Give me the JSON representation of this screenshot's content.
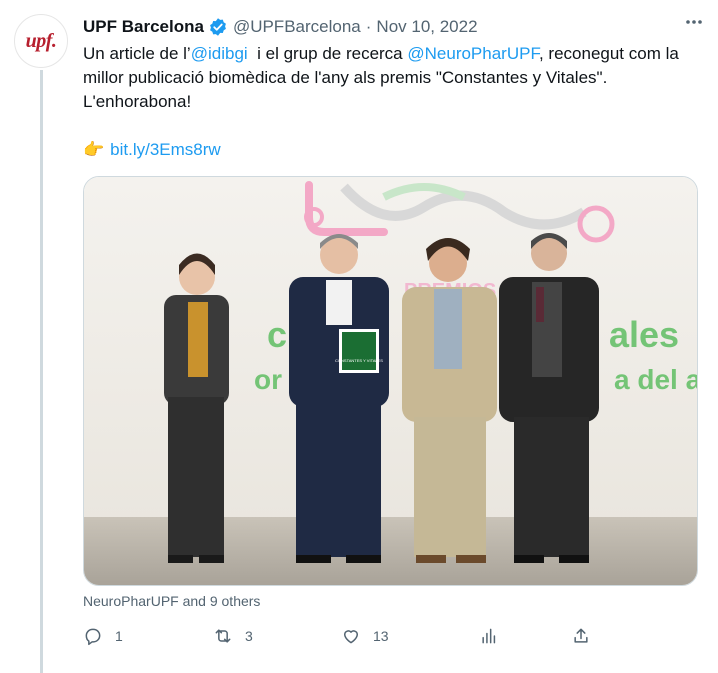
{
  "account": {
    "avatar_text": "upf.",
    "name": "UPF Barcelona",
    "handle": "@UPFBarcelona",
    "separator": "·",
    "date": "Nov 10, 2022",
    "verified_color": "#1d9bf0"
  },
  "tweet": {
    "line1_prefix": "Un article de l’",
    "mention1": "@idibgi",
    "line1_middle": "  i el grup de recerca ",
    "mention2": "@NeuroPharUPF",
    "line1_suffix": ", reconegut com la millor publicació biomèdica de l'any als premis \"Constantes y Vitales\". L'enhorabona!",
    "emoji": "👉",
    "link": "bit.ly/3Ems8rw"
  },
  "media": {
    "icon": "photo",
    "backdrop_texts": [
      "PREMIOS",
      "c",
      "ales",
      "or p",
      "a del a"
    ],
    "plaque_text": "CONSTANTES Y VITALES"
  },
  "tagged_text": "NeuroPharUPF and 9 others",
  "actions": {
    "reply_count": "1",
    "retweet_count": "3",
    "like_count": "13"
  },
  "colors": {
    "link": "#1d9bf0",
    "secondary_text": "#536471",
    "brand_red": "#b71f2e"
  }
}
